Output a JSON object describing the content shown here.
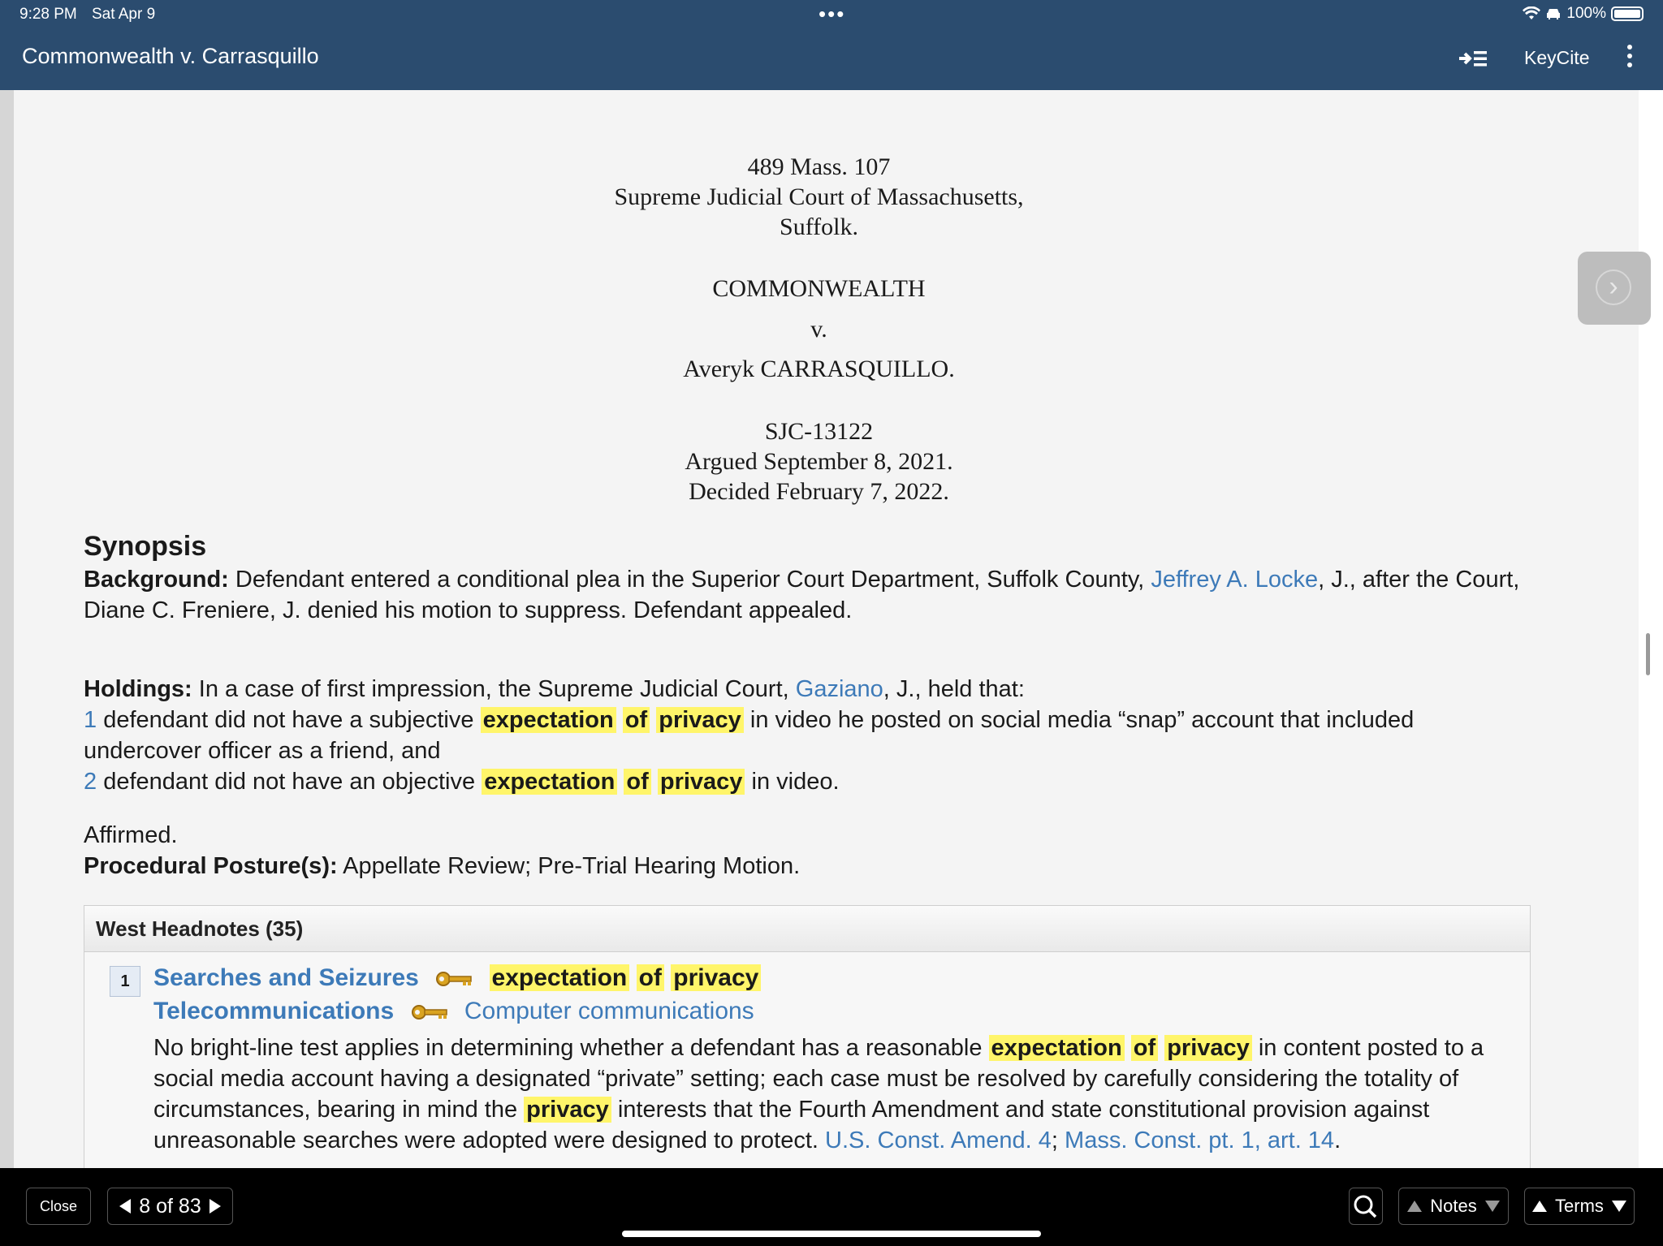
{
  "status_bar": {
    "time": "9:28 PM",
    "date": "Sat Apr 9",
    "battery": "100%"
  },
  "nav": {
    "title": "Commonwealth v. Carrasquillo",
    "keycite": "KeyCite"
  },
  "case_header": {
    "citation": "489 Mass. 107",
    "court": "Supreme Judicial Court of Massachusetts,",
    "county": "Suffolk.",
    "party1": "COMMONWEALTH",
    "versus": "v.",
    "party2": "Averyk CARRASQUILLO.",
    "docket": "SJC-13122",
    "argued": "Argued September 8, 2021.",
    "decided": "Decided February 7, 2022."
  },
  "synopsis": {
    "heading": "Synopsis",
    "background_label": "Background:",
    "background_text1": "Defendant entered a conditional plea in the Superior Court Department, Suffolk County,",
    "background_link": "Jeffrey A. Locke",
    "background_text2": ", J., after the Court, Diane C. Freniere, J. denied his motion to suppress. Defendant appealed.",
    "holdings_label": "Holdings:",
    "holdings_text1": "In a case of first impression, the Supreme Judicial Court,",
    "holdings_link": "Gaziano",
    "holdings_text2": ", J., held that:",
    "holding1_num": "1",
    "holding1_pre": "defendant did not have a subjective",
    "holding1_post": "in video he posted on social media “snap” account that included undercover officer as a friend, and",
    "holding2_num": "2",
    "holding2_pre": "defendant did not have an objective",
    "holding2_post": "in video.",
    "hl_expectation": "expectation",
    "hl_of": "of",
    "hl_privacy": "privacy",
    "affirmed": "Affirmed.",
    "posture_label": "Procedural Posture(s):",
    "posture_text": "Appellate Review; Pre-Trial Hearing Motion."
  },
  "headnotes": {
    "header": "West Headnotes (35)",
    "items": [
      {
        "number": "1",
        "topic1": "Searches and Seizures",
        "topic2": "Telecommunications",
        "subtopic2": "Computer communications",
        "text_pre": "No bright-line test applies in determining whether a defendant has a reasonable",
        "text_mid1": "in content posted to a social media account having a designated “private” setting; each case must be resolved by carefully considering the totality of circumstances, bearing in mind the",
        "text_mid2": "interests that the Fourth Amendment and state constitutional provision against unreasonable searches were adopted were designed to protect.",
        "link1": "U.S. Const. Amend. 4",
        "sep": ";",
        "link2": "Mass. Const. pt. 1, art. 14",
        "end": "."
      }
    ]
  },
  "toolbar": {
    "close": "Close",
    "pager": "8 of 83",
    "notes": "Notes",
    "terms": "Terms"
  },
  "colors": {
    "nav_bg": "#2b4c6f",
    "link": "#3d7ab8",
    "highlight": "#fff56a"
  },
  "icons": [
    "wifi-icon",
    "car-icon",
    "battery-icon",
    "outline-icon",
    "more-vertical-icon",
    "chevron-right-icon",
    "key-icon",
    "search-icon",
    "triangle-left-icon",
    "triangle-right-icon"
  ]
}
